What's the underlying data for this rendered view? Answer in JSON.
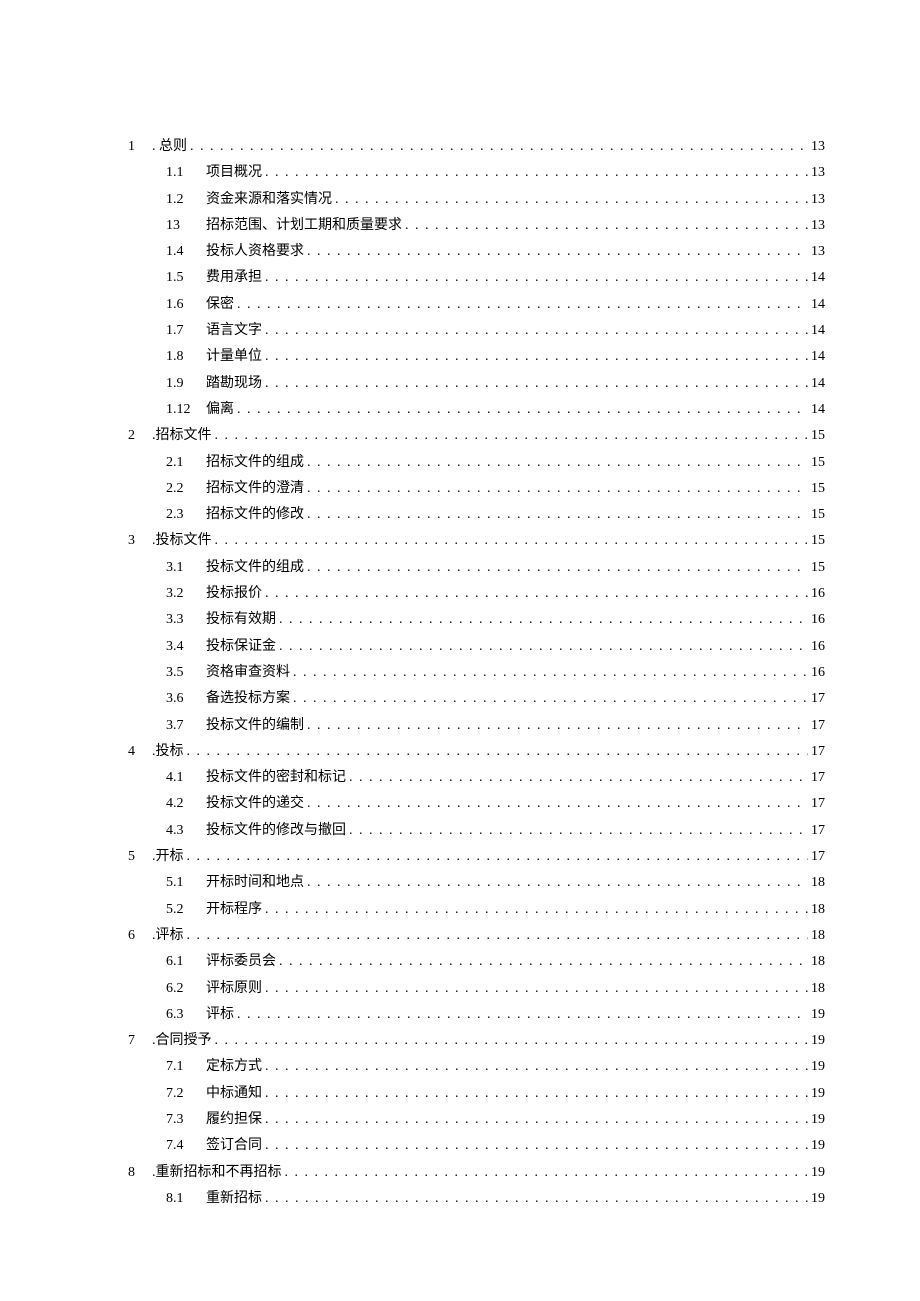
{
  "toc": [
    {
      "level": 1,
      "num": "1",
      "title": " . 总则",
      "page": "13"
    },
    {
      "level": 2,
      "num": "1.1",
      "title": "项目概况",
      "page": "13"
    },
    {
      "level": 2,
      "num": "1.2",
      "title": "资金来源和落实情况",
      "page": "13"
    },
    {
      "level": 2,
      "num": "13",
      "title": " 招标范围、计划工期和质量要求",
      "page": "13"
    },
    {
      "level": 2,
      "num": "1.4",
      "title": "投标人资格要求",
      "page": "13"
    },
    {
      "level": 2,
      "num": "1.5",
      "title": "费用承担",
      "page": "14"
    },
    {
      "level": 2,
      "num": "1.6",
      "title": "保密",
      "page": "14"
    },
    {
      "level": 2,
      "num": "1.7",
      "title": "语言文字",
      "page": "14"
    },
    {
      "level": 2,
      "num": "1.8",
      "title": "计量单位",
      "page": "14"
    },
    {
      "level": 2,
      "num": "1.9",
      "title": "踏勘现场",
      "page": "14"
    },
    {
      "level": 2,
      "num": "1.12",
      "title": " 偏离",
      "page": "14"
    },
    {
      "level": 1,
      "num": "2",
      "title": " .招标文件",
      "page": "15"
    },
    {
      "level": 2,
      "num": "2.1",
      "title": "招标文件的组成",
      "page": "15"
    },
    {
      "level": 2,
      "num": "2.2",
      "title": "招标文件的澄清",
      "page": "15"
    },
    {
      "level": 2,
      "num": "2.3",
      "title": "招标文件的修改",
      "page": "15"
    },
    {
      "level": 1,
      "num": "3",
      "title": " .投标文件",
      "page": "15"
    },
    {
      "level": 2,
      "num": "3.1",
      "title": "投标文件的组成",
      "page": "15"
    },
    {
      "level": 2,
      "num": "3.2",
      "title": "投标报价",
      "page": "16"
    },
    {
      "level": 2,
      "num": "3.3",
      "title": "投标有效期",
      "page": "16"
    },
    {
      "level": 2,
      "num": "3.4",
      "title": "投标保证金",
      "page": "16"
    },
    {
      "level": 2,
      "num": "3.5",
      "title": "资格审查资料",
      "page": "16"
    },
    {
      "level": 2,
      "num": "3.6",
      "title": "备选投标方案",
      "page": "17"
    },
    {
      "level": 2,
      "num": "3.7",
      "title": "投标文件的编制",
      "page": "17"
    },
    {
      "level": 1,
      "num": "4",
      "title": " .投标",
      "page": "17"
    },
    {
      "level": 2,
      "num": "4.1",
      "title": "投标文件的密封和标记",
      "page": "17"
    },
    {
      "level": 2,
      "num": "4.2",
      "title": "投标文件的递交",
      "page": "17"
    },
    {
      "level": 2,
      "num": "4.3",
      "title": "投标文件的修改与撤回",
      "page": "17"
    },
    {
      "level": 1,
      "num": "5",
      "title": " .开标",
      "page": "17"
    },
    {
      "level": 2,
      "num": "5.1",
      "title": "开标时间和地点",
      "page": "18"
    },
    {
      "level": 2,
      "num": "5.2",
      "title": "开标程序",
      "page": "18"
    },
    {
      "level": 1,
      "num": "6",
      "title": " .评标",
      "page": "18"
    },
    {
      "level": 2,
      "num": "6.1",
      "title": "评标委员会",
      "page": "18"
    },
    {
      "level": 2,
      "num": "6.2",
      "title": "评标原则",
      "page": "18"
    },
    {
      "level": 2,
      "num": "6.3",
      "title": "评标",
      "page": "19"
    },
    {
      "level": 1,
      "num": "7",
      "title": " .合同授予",
      "page": "19"
    },
    {
      "level": 2,
      "num": "7.1",
      "title": "定标方式",
      "page": "19"
    },
    {
      "level": 2,
      "num": "7.2",
      "title": "中标通知",
      "page": "19"
    },
    {
      "level": 2,
      "num": "7.3",
      "title": "履约担保",
      "page": "19"
    },
    {
      "level": 2,
      "num": "7.4",
      "title": "签订合同",
      "page": "19"
    },
    {
      "level": 1,
      "num": "8",
      "title": " .重新招标和不再招标",
      "page": "19"
    },
    {
      "level": 2,
      "num": "8.1",
      "title": "重新招标",
      "page": "19"
    }
  ]
}
